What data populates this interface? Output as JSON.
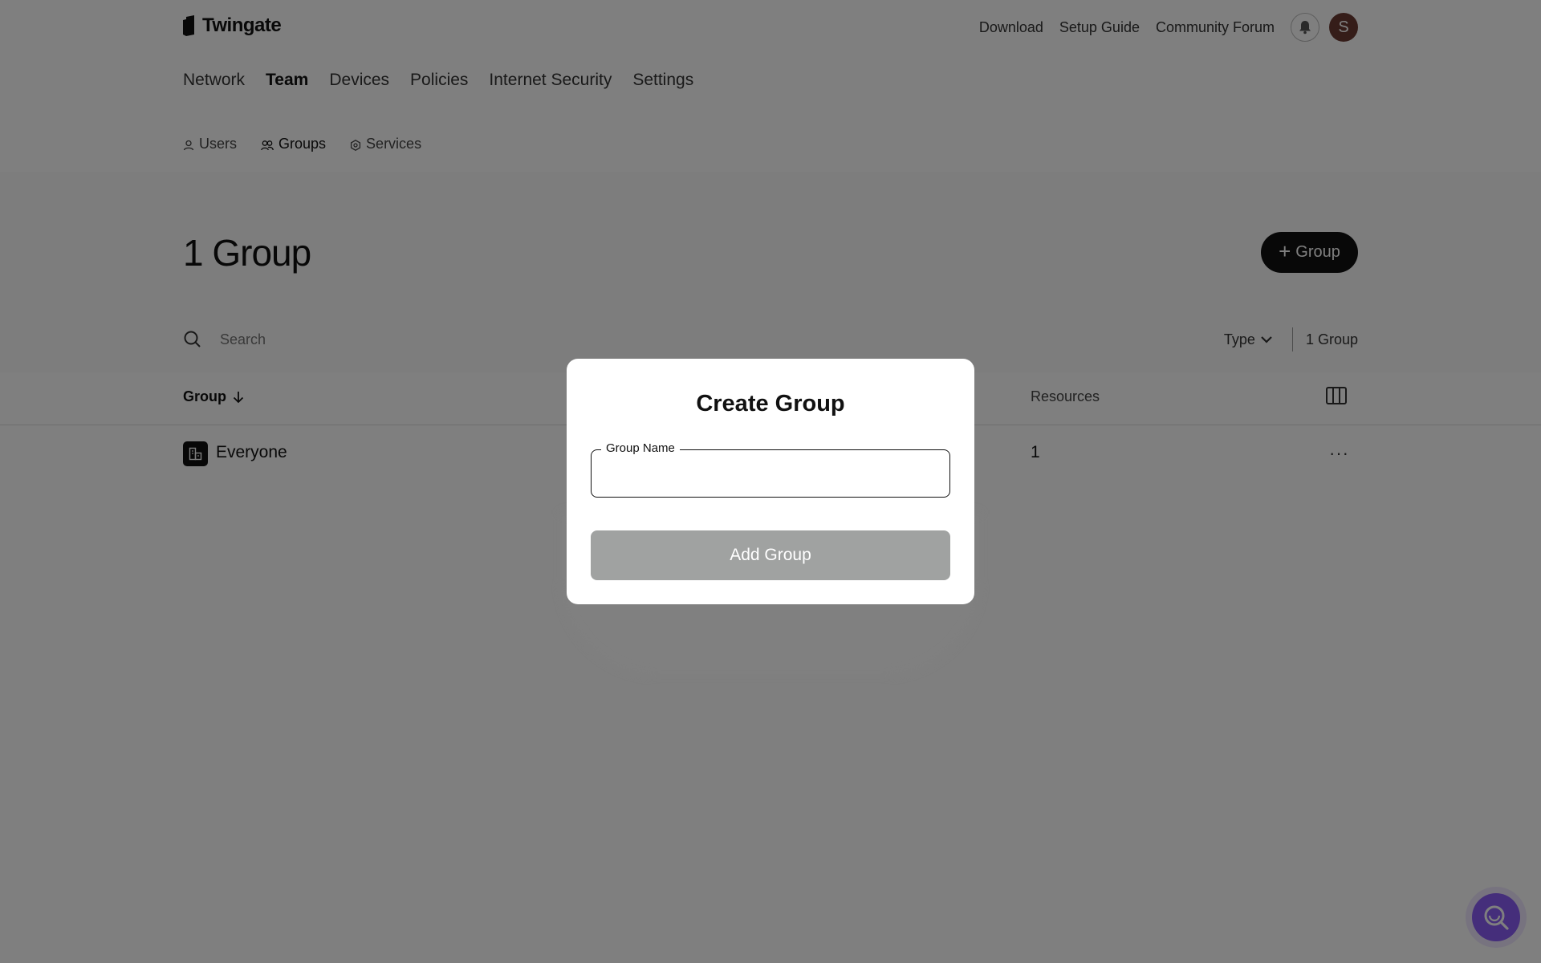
{
  "header": {
    "brand": "Twingate",
    "links": [
      "Download",
      "Setup Guide",
      "Community Forum"
    ],
    "avatar_initial": "S"
  },
  "main_nav": {
    "items": [
      "Network",
      "Team",
      "Devices",
      "Policies",
      "Internet Security",
      "Settings"
    ],
    "active": "Team"
  },
  "sub_nav": {
    "items": [
      {
        "label": "Users",
        "icon": "user-icon"
      },
      {
        "label": "Groups",
        "icon": "users-icon"
      },
      {
        "label": "Services",
        "icon": "gear-icon"
      }
    ],
    "active": "Groups"
  },
  "page": {
    "title": "1 Group",
    "add_button_label": "Group"
  },
  "search": {
    "placeholder": "Search",
    "type_filter_label": "Type",
    "count_label": "1 Group"
  },
  "table": {
    "columns": [
      "Group",
      "Resources"
    ],
    "rows": [
      {
        "name": "Everyone",
        "resources": "1"
      }
    ],
    "more_label": "···"
  },
  "modal": {
    "title": "Create Group",
    "field_label": "Group Name",
    "field_value": "",
    "submit_label": "Add Group"
  },
  "colors": {
    "primary": "#111111",
    "disabled_button": "#a0a2a1",
    "help_fab": "#8b5cf6",
    "avatar_bg": "#6b3a32"
  }
}
